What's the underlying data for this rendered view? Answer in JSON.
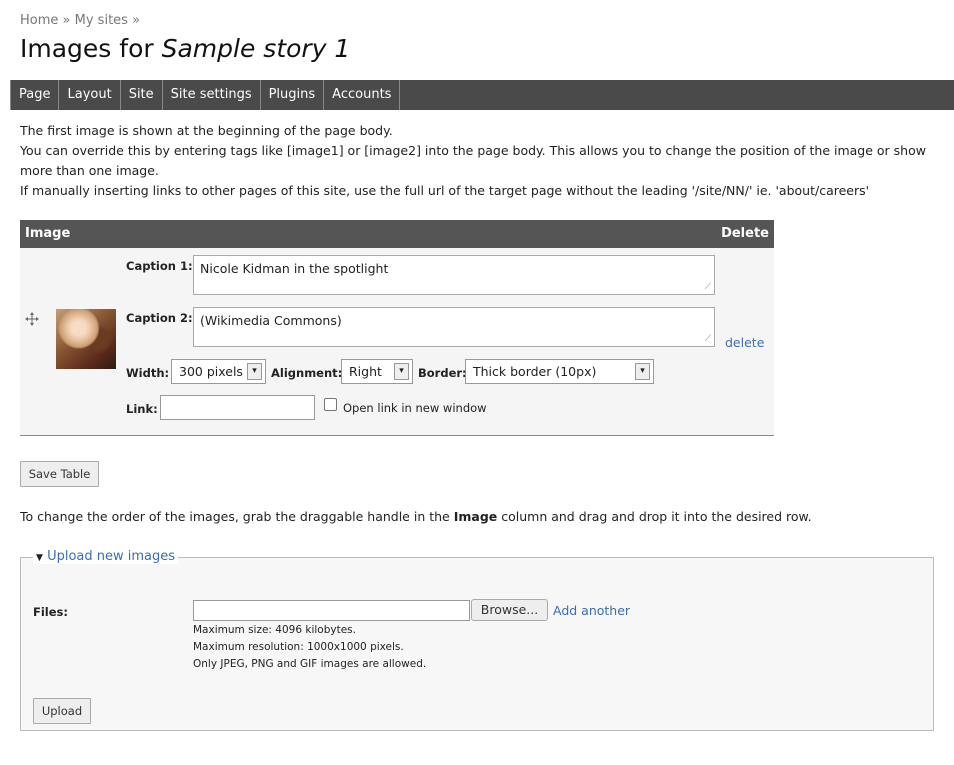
{
  "breadcrumb": {
    "home": "Home",
    "sep1": "»",
    "my_sites": "My sites",
    "sep2": "»"
  },
  "title": {
    "prefix": "Images for",
    "story": "Sample story 1"
  },
  "tabs": [
    {
      "label": "Page"
    },
    {
      "label": "Layout"
    },
    {
      "label": "Site"
    },
    {
      "label": "Site settings"
    },
    {
      "label": "Plugins"
    },
    {
      "label": "Accounts"
    }
  ],
  "intro": {
    "line1": "The first image is shown at the beginning of the page body.",
    "line2": "You can override this by entering tags like [image1] or [image2] into the page body. This allows you to change the position of the image or show more than one image.",
    "line3": "If manually inserting links to other pages of this site, use the full url of the target page without the leading '/site/NN/' ie. 'about/careers'"
  },
  "table": {
    "col_image": "Image",
    "col_delete": "Delete",
    "row": {
      "caption1_label": "Caption 1:",
      "caption1_value": "Nicole Kidman in the spotlight",
      "caption2_label": "Caption 2:",
      "caption2_value": "(Wikimedia Commons)",
      "width_label": "Width:",
      "width_value": "300 pixels",
      "alignment_label": "Alignment:",
      "alignment_value": "Right",
      "border_label": "Border:",
      "border_value": "Thick border (10px)",
      "link_label": "Link:",
      "link_value": "",
      "new_window_label": "Open link in new window",
      "new_window_checked": false,
      "delete_label": "delete"
    }
  },
  "save_button": "Save Table",
  "order_help": {
    "before": "To change the order of the images, grab the draggable handle in the ",
    "bold": "Image",
    "after": " column and drag and drop it into the desired row."
  },
  "upload": {
    "legend": "Upload new images",
    "files_label": "Files:",
    "browse_label": "Browse...",
    "add_another": "Add another",
    "max_size": "Maximum size: 4096 kilobytes.",
    "max_resolution": "Maximum resolution: 1000x1000 pixels.",
    "allowed": "Only JPEG, PNG and GIF images are allowed.",
    "upload_button": "Upload"
  },
  "icons": {
    "drag_handle": "move-cross-icon",
    "legend_toggle": "triangle-down-icon",
    "select_arrow": "chevron-down-icon"
  },
  "colors": {
    "tab_bar": "#4a4a4a",
    "table_header": "#555555",
    "link": "#3b6db5"
  }
}
